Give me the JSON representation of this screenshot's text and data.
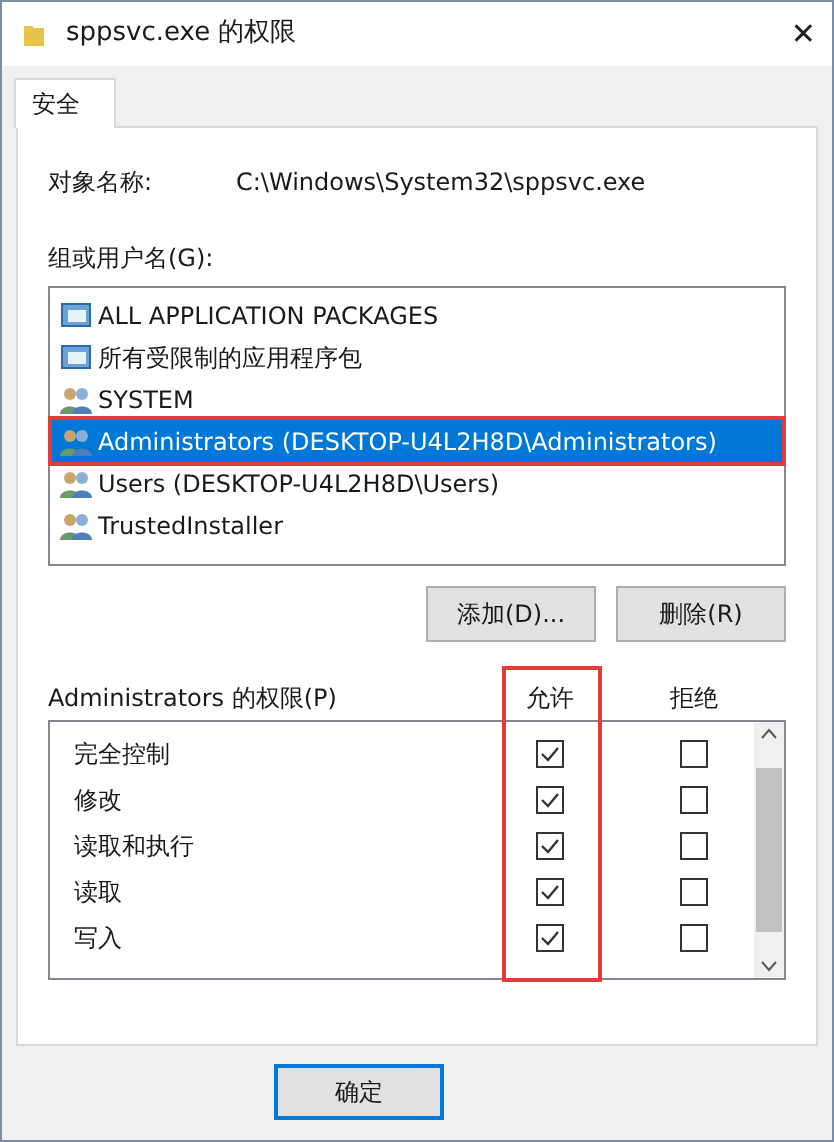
{
  "window": {
    "title": "sppsvc.exe 的权限",
    "close": "✕"
  },
  "tabs": [
    {
      "label": "安全",
      "selected": true
    }
  ],
  "object_name": {
    "label": "对象名称:",
    "value": "C:\\Windows\\System32\\sppsvc.exe"
  },
  "groups": {
    "label": "组或用户名(G):",
    "items": [
      {
        "name": "ALL APPLICATION PACKAGES",
        "kind": "package",
        "selected": false,
        "highlighted": false
      },
      {
        "name": "所有受限制的应用程序包",
        "kind": "package",
        "selected": false,
        "highlighted": false
      },
      {
        "name": "SYSTEM",
        "kind": "user",
        "selected": false,
        "highlighted": false
      },
      {
        "name": "Administrators (DESKTOP-U4L2H8D\\Administrators)",
        "kind": "user",
        "selected": true,
        "highlighted": true
      },
      {
        "name": "Users (DESKTOP-U4L2H8D\\Users)",
        "kind": "user",
        "selected": false,
        "highlighted": false
      },
      {
        "name": "TrustedInstaller",
        "kind": "user",
        "selected": false,
        "highlighted": false
      }
    ]
  },
  "group_buttons": [
    "添加(D)...",
    "删除(R)"
  ],
  "permissions": {
    "label": "Administrators 的权限(P)",
    "allow_header": "允许",
    "deny_header": "拒绝",
    "allow_highlighted": true,
    "rows": [
      {
        "name": "完全控制",
        "allow": true,
        "deny": false
      },
      {
        "name": "修改",
        "allow": true,
        "deny": false
      },
      {
        "name": "读取和执行",
        "allow": true,
        "deny": false
      },
      {
        "name": "读取",
        "allow": true,
        "deny": false
      },
      {
        "name": "写入",
        "allow": true,
        "deny": false
      }
    ]
  },
  "buttons": [
    {
      "label": "确定",
      "default": true
    }
  ]
}
